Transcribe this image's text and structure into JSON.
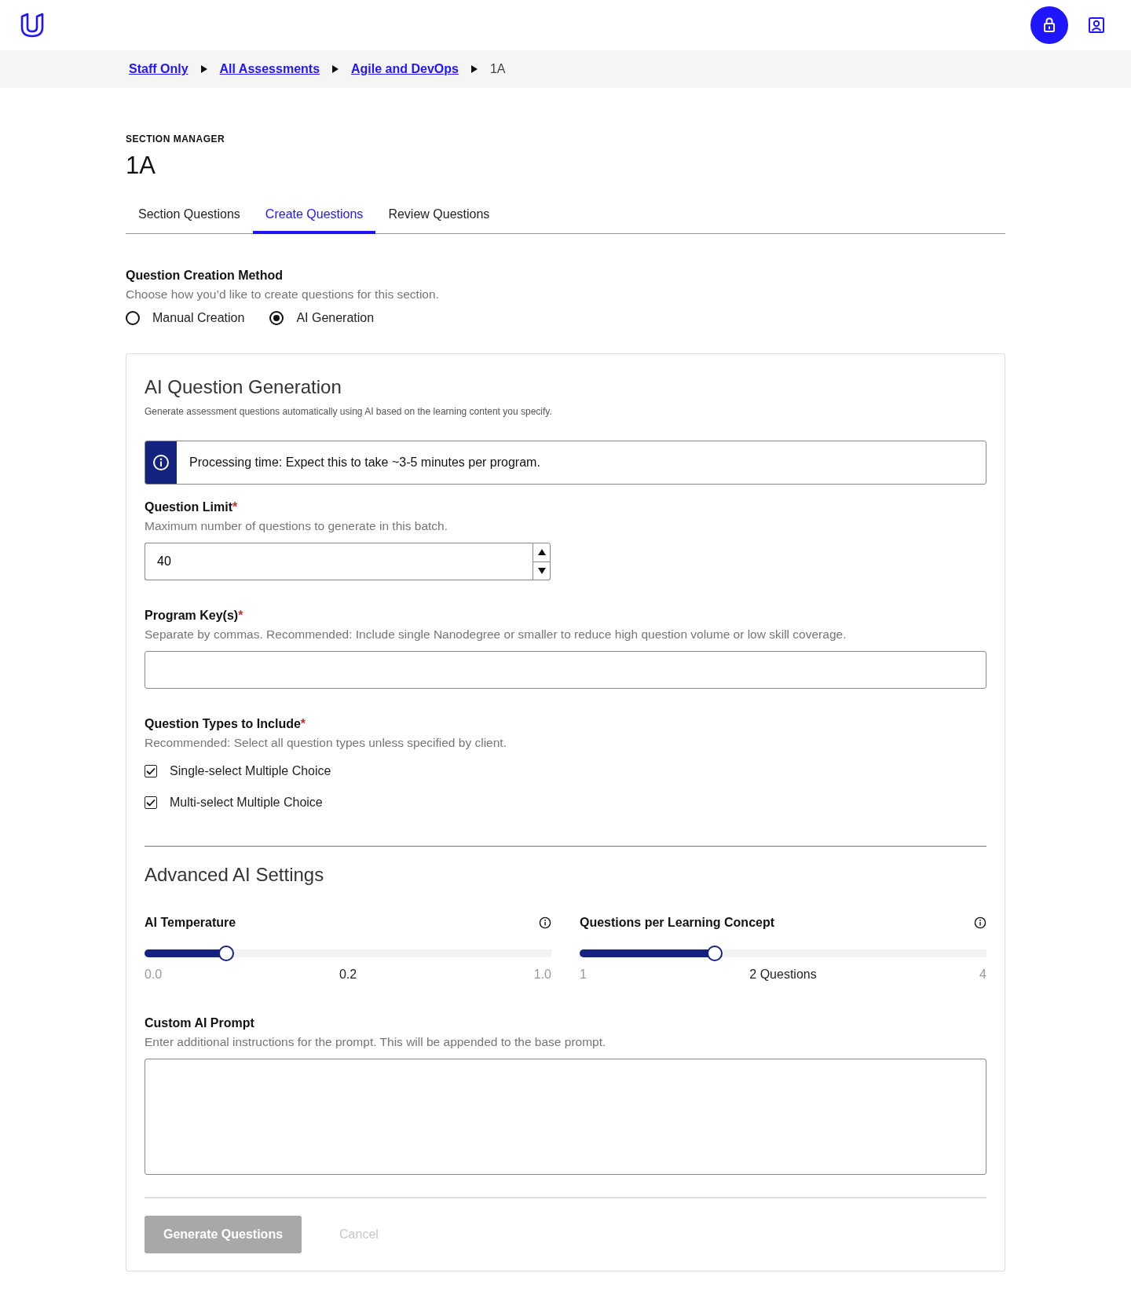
{
  "header": {
    "lock_button": {
      "kind": "lock"
    },
    "profile_button": {
      "kind": "profile"
    }
  },
  "breadcrumb": [
    {
      "label": "Staff Only",
      "link": true
    },
    {
      "label": "All Assessments",
      "link": true
    },
    {
      "label": "Agile and DevOps",
      "link": true
    },
    {
      "label": "1A",
      "link": false
    }
  ],
  "page": {
    "eyebrow": "SECTION MANAGER",
    "title": "1A"
  },
  "tabs": [
    {
      "label": "Section Questions",
      "selected": false
    },
    {
      "label": "Create Questions",
      "selected": true
    },
    {
      "label": "Review Questions",
      "selected": false
    }
  ],
  "creation_method": {
    "label": "Question Creation Method",
    "description": "Choose how you’d like to create questions for this section.",
    "options": [
      {
        "label": "Manual Creation",
        "selected": false
      },
      {
        "label": "AI Generation",
        "selected": true
      }
    ]
  },
  "ai_card": {
    "title": "AI Question Generation",
    "description": "Generate assessment questions automatically using AI based on the learning content you specify.",
    "notice": "Processing time: Expect this to take ~3-5 minutes per program.",
    "question_limit": {
      "label": "Question Limit",
      "required_mark": "*",
      "description": "Maximum number of questions to generate in this batch.",
      "value": "40"
    },
    "program_keys": {
      "label": "Program Key(s)",
      "required_mark": "*",
      "description": "Separate by commas. Recommended: Include single Nanodegree or smaller to reduce high question volume or low skill coverage."
    },
    "question_types": {
      "label": "Question Types to Include",
      "required_mark": "*",
      "description": "Recommended: Select all question types unless specified by client.",
      "options": [
        {
          "label": "Single-select Multiple Choice",
          "checked": true
        },
        {
          "label": "Multi-select Multiple Choice",
          "checked": true
        }
      ]
    },
    "advanced": {
      "title": "Advanced AI Settings",
      "sliders": [
        {
          "label": "AI Temperature",
          "level": 0.2,
          "min": "0.0",
          "reading": "0.2",
          "max": "1.0"
        },
        {
          "label": "Questions per Learning Concept",
          "level": 0.333,
          "min": "1",
          "reading": "2 Questions",
          "max": "4"
        }
      ]
    },
    "custom_prompt": {
      "label": "Custom AI Prompt",
      "description": "Enter additional instructions for the prompt. This will be appended to the base prompt."
    },
    "buttons": [
      {
        "label": "Generate Questions",
        "kind": "primary",
        "disabled": true
      },
      {
        "label": "Cancel",
        "kind": "link",
        "disabled": true
      }
    ]
  }
}
